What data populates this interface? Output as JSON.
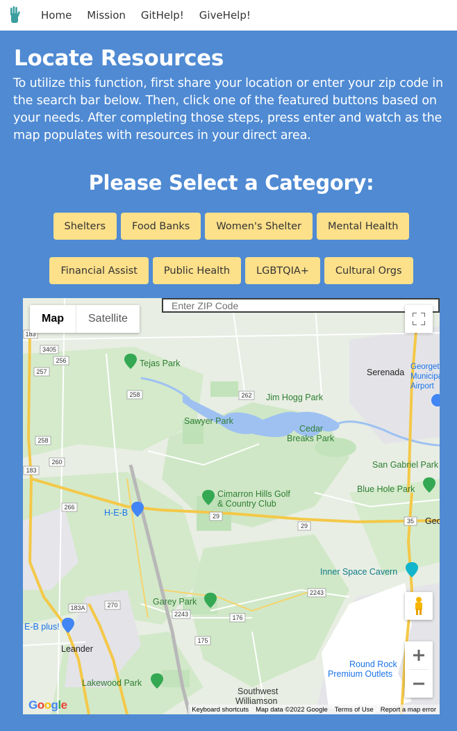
{
  "nav": {
    "items": [
      "Home",
      "Mission",
      "GitHelp!",
      "GiveHelp!"
    ]
  },
  "heading": "Locate Resources",
  "intro": "To utilize this function, first share your location or enter your zip code in the search bar below. Then, click one of the featured buttons based on your needs. After completing those steps, press enter and watch as the map populates with resources in your direct area.",
  "category_heading": "Please Select a Category:",
  "categories_row1": [
    "Shelters",
    "Food Banks",
    "Women's Shelter",
    "Mental Health"
  ],
  "categories_row2": [
    "Financial Assist",
    "Public Health",
    "LGBTQIA+",
    "Cultural Orgs"
  ],
  "map": {
    "zip_placeholder": "Enter ZIP Code",
    "type_map": "Map",
    "type_satellite": "Satellite",
    "google_logo": "Google",
    "footer": {
      "shortcuts": "Keyboard shortcuts",
      "data": "Map data ©2022 Google",
      "terms": "Terms of Use",
      "report": "Report a map error"
    },
    "places": {
      "tejas_park": "Tejas Park",
      "serenada": "Serenada",
      "georgetown_airport": "Georgetown Municipal Airport",
      "jim_hogg_park": "Jim Hogg Park",
      "sawyer_park": "Sawyer Park",
      "cedar_breaks_1": "Cedar",
      "cedar_breaks_2": "Breaks Park",
      "san_gabriel_park": "San Gabriel Park",
      "blue_hole_park": "Blue Hole Park",
      "cimarron_1": "Cimarron Hills Golf",
      "cimarron_2": "& Country Club",
      "heb": "H-E-B",
      "georgetown": "Georget",
      "inner_space": "Inner Space Cavern",
      "garey_park": "Garey Park",
      "heb_plus": "E-B plus!",
      "leander": "Leander",
      "lakewood_park": "Lakewood Park",
      "round_rock_1": "Round Rock",
      "round_rock_2": "Premium Outlets",
      "southwest_1": "Southwest",
      "southwest_2": "Williamson"
    },
    "road_labels": [
      "183",
      "3405",
      "256",
      "257",
      "258",
      "262",
      "258",
      "260",
      "183",
      "266",
      "29",
      "29",
      "35",
      "2243",
      "183A",
      "270",
      "2243",
      "176",
      "175"
    ]
  },
  "colors": {
    "background": "#4f8ad3",
    "button": "#fce08a",
    "water": "#9ec1f2",
    "park": "#c6e6c2",
    "highway": "#f7d36b"
  }
}
